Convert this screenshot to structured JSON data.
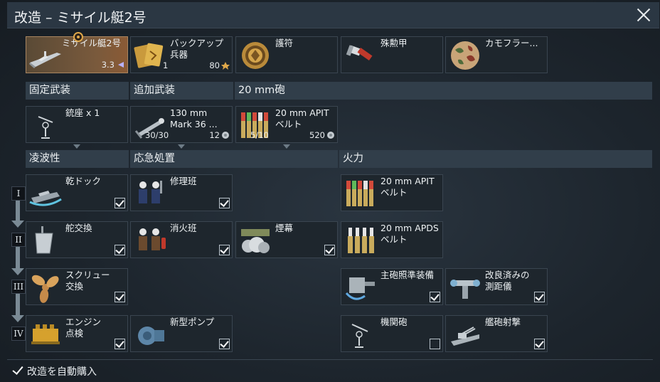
{
  "window": {
    "title": "改造 – ミサイル艇2号"
  },
  "top_row": [
    {
      "label": "ミサイル艇2号",
      "value": "3.3"
    },
    {
      "label": "バックアップ\n兵器",
      "count": "1",
      "price": "80"
    },
    {
      "label": "護符"
    },
    {
      "label": "殊勲甲"
    },
    {
      "label": "カモフラー..."
    }
  ],
  "sections": {
    "fixed_armament": "固定武装",
    "additional_armament": "追加武装",
    "gun_20mm": "20 mm砲",
    "seaworthiness": "凌波性",
    "damage_control": "応急処置",
    "firepower": "火力"
  },
  "armament": [
    {
      "label": "銃座 x 1"
    },
    {
      "label": "130 mm\nMark 36 ...",
      "ammo": "30/30",
      "cost": "12"
    },
    {
      "label": "20 mm APIT\nベルト",
      "ammo": "5/10",
      "cost": "520"
    }
  ],
  "tiers": [
    "I",
    "II",
    "III",
    "IV"
  ],
  "modules": [
    {
      "label": "乾ドック",
      "checked": true
    },
    {
      "label": "修理班",
      "checked": true
    },
    {
      "label": "20 mm APIT\nベルト",
      "checked": false
    },
    {
      "label": "舵交換",
      "checked": true
    },
    {
      "label": "消火班",
      "checked": true
    },
    {
      "label": "煙幕",
      "checked": true
    },
    {
      "label": "20 mm APDS\nベルト",
      "checked": false
    },
    {
      "label": "スクリュー\n交換",
      "checked": true
    },
    {
      "label": "主砲照準装備",
      "checked": true
    },
    {
      "label": "改良済みの\n測距儀",
      "checked": true
    },
    {
      "label": "エンジン\n点検",
      "checked": true
    },
    {
      "label": "新型ポンプ",
      "checked": true
    },
    {
      "label": "機関砲",
      "checked": false
    },
    {
      "label": "艦砲射撃",
      "checked": true
    }
  ],
  "footer": {
    "auto_buy_label": "改造を自動購入",
    "auto_buy_checked": true
  },
  "colors": {
    "header_bg": "#313e4a",
    "card_bg": "#1e262d",
    "accent_gold": "#e0a84a",
    "tier_arrow": "#7a8a95"
  }
}
